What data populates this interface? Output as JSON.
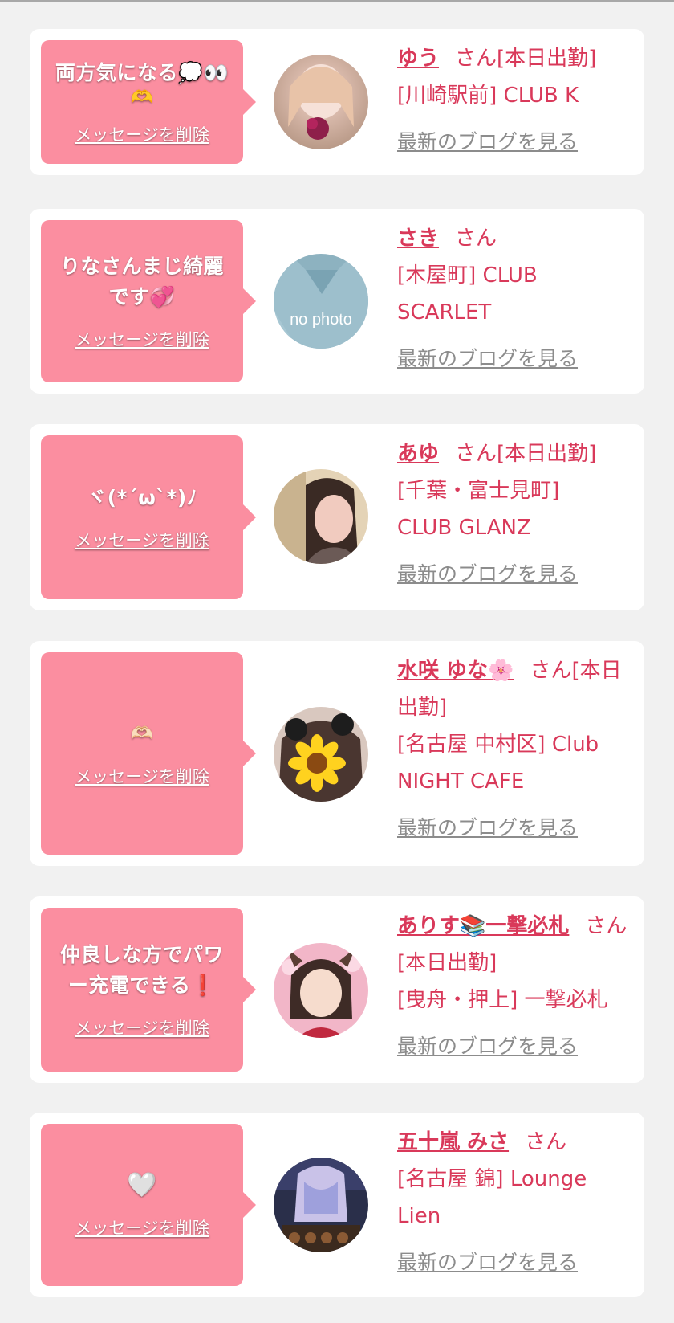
{
  "delete_label": "メッセージを削除",
  "blog_label": "最新のブログを見る",
  "san_label": "さん",
  "cards": [
    {
      "message": "両方気になる💭👀",
      "message_extra": "🫶",
      "name": "ゆう",
      "status": "[本日出勤]",
      "shop": "[川崎駅前] CLUB K"
    },
    {
      "message": "りなさんまじ綺麗です💞",
      "message_extra": "",
      "name": "さき",
      "status": "",
      "shop": "[木屋町] CLUB SCARLET",
      "avatar_text": "no photo"
    },
    {
      "message": "ヾ(*´ω`*)ﾉ",
      "message_extra": "",
      "name": "あゆ",
      "status": "[本日出勤]",
      "shop": "[千葉・富士見町] CLUB GLANZ"
    },
    {
      "message": "🫶🏻",
      "message_extra": "",
      "name": "水咲 ゆな🌸",
      "status": "[本日出勤]",
      "shop": "[名古屋 中村区] Club NIGHT CAFE"
    },
    {
      "message": "仲良しな方でパワー充電できる❗️",
      "message_extra": "",
      "name": "ありす📚一撃必札",
      "status": "[本日出勤]",
      "shop": "[曳舟・押上] 一撃必札"
    },
    {
      "message": "🤍",
      "message_extra": "",
      "name": "五十嵐 みさ",
      "status": "",
      "shop": "[名古屋 錦] Lounge Lien"
    }
  ],
  "colors": {
    "bubble": "#fb8ea0",
    "accent": "#d9395a",
    "link_gray": "#8c8c8c",
    "background": "#f1f1f1"
  }
}
